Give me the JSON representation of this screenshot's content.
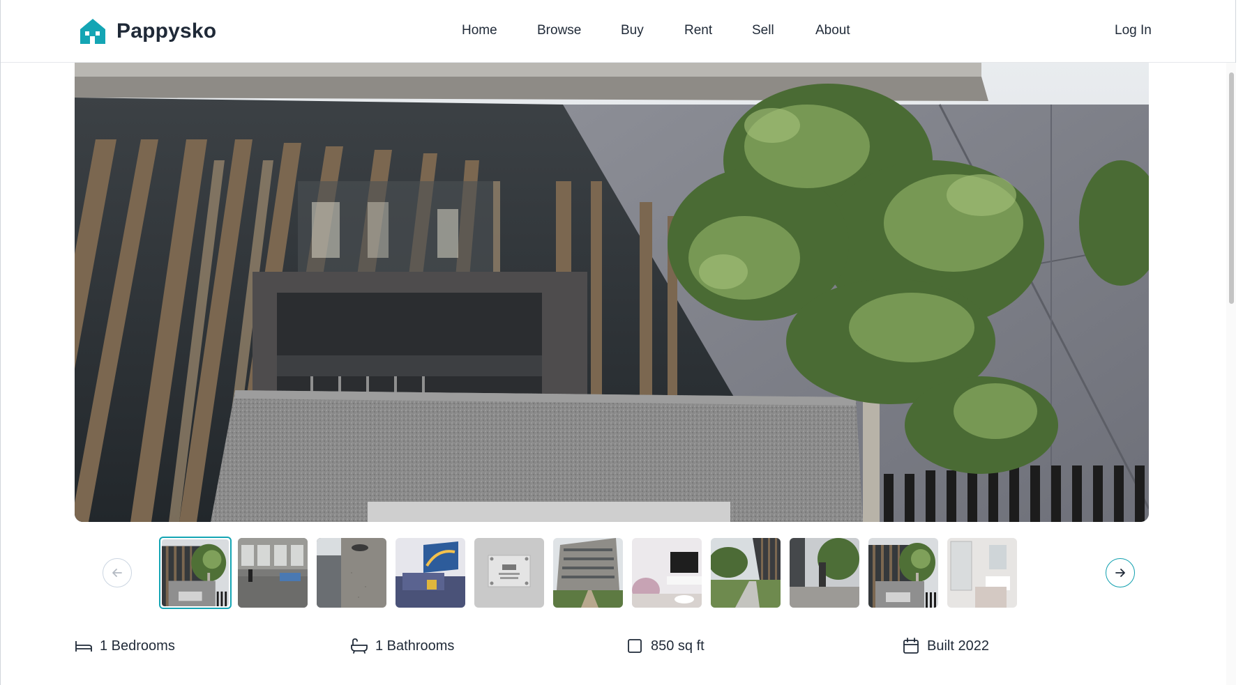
{
  "brand": {
    "name": "Pappysko",
    "icon": "house-icon",
    "accent": "#14a5b4"
  },
  "nav": {
    "items": [
      {
        "label": "Home"
      },
      {
        "label": "Browse"
      },
      {
        "label": "Buy"
      },
      {
        "label": "Rent"
      },
      {
        "label": "Sell"
      },
      {
        "label": "About"
      }
    ]
  },
  "auth": {
    "login_label": "Log In"
  },
  "gallery": {
    "hero_image": "building-facade-photo",
    "thumbnails": [
      {
        "subject": "building-entrance",
        "active": true
      },
      {
        "subject": "gym"
      },
      {
        "subject": "ceiling-shower"
      },
      {
        "subject": "living-room-sofa"
      },
      {
        "subject": "cctv-sign"
      },
      {
        "subject": "apartment-building"
      },
      {
        "subject": "living-room-tv"
      },
      {
        "subject": "garden-walkway"
      },
      {
        "subject": "parking-entrance"
      },
      {
        "subject": "building-entrance"
      },
      {
        "subject": "bathroom"
      }
    ],
    "prev_icon": "arrow-left-icon",
    "next_icon": "arrow-right-icon"
  },
  "features": {
    "bedrooms": {
      "label": "1 Bedrooms",
      "icon": "bed-icon"
    },
    "bathrooms": {
      "label": "1 Bathrooms",
      "icon": "bathtub-icon"
    },
    "area": {
      "label": "850 sq ft",
      "icon": "square-icon"
    },
    "built": {
      "label": "Built 2022",
      "icon": "calendar-icon"
    }
  }
}
